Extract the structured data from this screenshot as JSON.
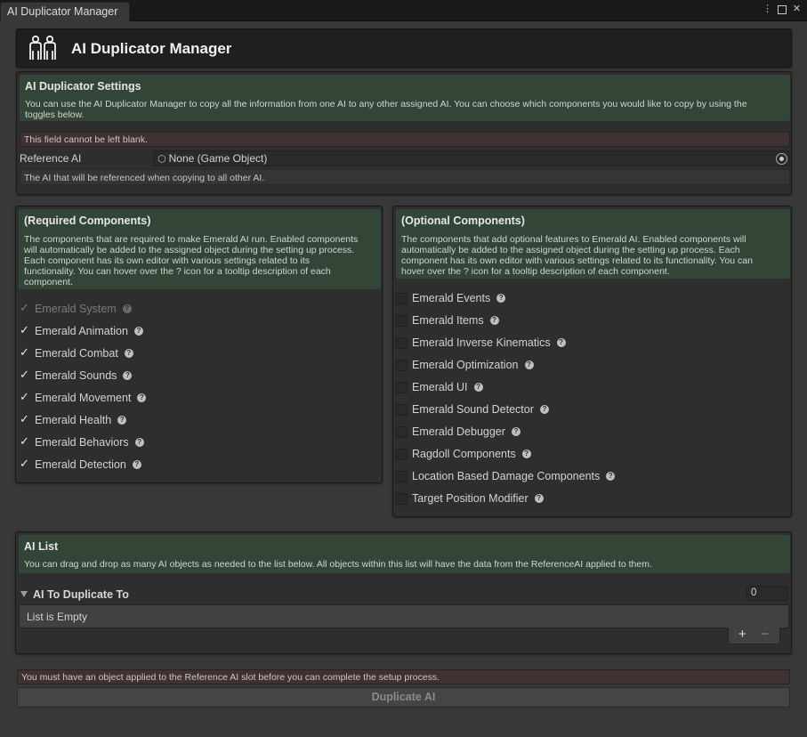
{
  "window": {
    "tab_title": "AI Duplicator Manager"
  },
  "header": {
    "title": "AI Duplicator Manager"
  },
  "settings": {
    "title": "AI Duplicator Settings",
    "description_lines": [
      "You can use the AI Duplicator Manager to copy all the information from one AI to any other assigned AI. You can choose which components you would like to copy by using the",
      "toggles below."
    ],
    "warning": "This field cannot be left blank.",
    "reference_label": "Reference AI",
    "reference_value": "None (Game Object)",
    "reference_note": "The AI that will be referenced when copying to all other AI."
  },
  "required": {
    "title": "(Required Components)",
    "description_lines": [
      "The components that are required to make Emerald AI run. Enabled components",
      "will automatically be added to the assigned object during the setting up process.",
      "Each component has its own editor with various settings related to its",
      "functionality. You can hover over the ? icon for a tooltip description of each",
      "component."
    ],
    "items": [
      {
        "label": "Emerald System",
        "checked": true,
        "disabled": true
      },
      {
        "label": "Emerald Animation",
        "checked": true
      },
      {
        "label": "Emerald Combat",
        "checked": true
      },
      {
        "label": "Emerald Sounds",
        "checked": true
      },
      {
        "label": "Emerald Movement",
        "checked": true
      },
      {
        "label": "Emerald Health",
        "checked": true
      },
      {
        "label": "Emerald Behaviors",
        "checked": true
      },
      {
        "label": "Emerald Detection",
        "checked": true
      }
    ]
  },
  "optional": {
    "title": "(Optional Components)",
    "description_lines": [
      "The components that add optional features to Emerald AI. Enabled components will",
      "automatically be added to the assigned object during the setting up process. Each",
      "component has its own editor with various settings related to its functionality. You can",
      "hover over the ? icon for a tooltip description of each component."
    ],
    "items": [
      {
        "label": "Emerald Events",
        "checked": false
      },
      {
        "label": "Emerald Items",
        "checked": false
      },
      {
        "label": "Emerald Inverse Kinematics",
        "checked": false
      },
      {
        "label": "Emerald Optimization",
        "checked": false
      },
      {
        "label": "Emerald UI",
        "checked": false
      },
      {
        "label": "Emerald Sound Detector",
        "checked": false
      },
      {
        "label": "Emerald Debugger",
        "checked": false
      },
      {
        "label": "Ragdoll Components",
        "checked": false
      },
      {
        "label": "Location Based Damage Components",
        "checked": false
      },
      {
        "label": "Target Position Modifier",
        "checked": false
      }
    ]
  },
  "ai_list": {
    "title": "AI List",
    "description": "You can drag and drop as many AI objects as needed to the list below. All objects within this list will have the data from the ReferenceAI applied to them.",
    "list_label": "AI To Duplicate To",
    "count": "0",
    "empty_text": "List is Empty",
    "add_symbol": "+",
    "remove_symbol": "−"
  },
  "footer": {
    "warning": "You must have an object applied to the Reference AI slot before you can complete the setup process.",
    "button_label": "Duplicate AI"
  },
  "colors": {
    "info_bg": "#334536",
    "warning_bg": "#3e3131",
    "panel_bg": "#2e2e2e"
  }
}
